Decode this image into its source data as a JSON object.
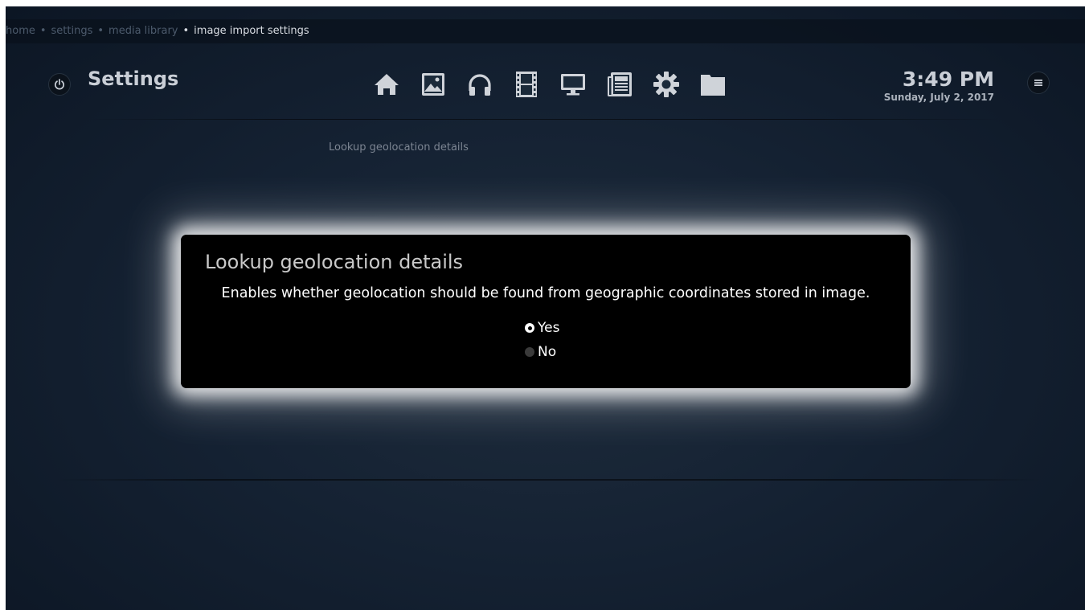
{
  "breadcrumb": {
    "items": [
      "home",
      "settings",
      "media library"
    ],
    "separator": "•",
    "current": "image import settings"
  },
  "header": {
    "title": "Settings",
    "time": "3:49 PM",
    "date": "Sunday, July 2, 2017",
    "nav_icons": [
      "home-icon",
      "pictures-icon",
      "music-icon",
      "videos-icon",
      "tv-icon",
      "news-icon",
      "settings-icon",
      "files-icon"
    ]
  },
  "setting_label": "Lookup geolocation details",
  "dialog": {
    "title": "Lookup geolocation details",
    "description": "Enables whether geolocation should be found from geographic coordinates stored in image.",
    "options": [
      {
        "label": "Yes",
        "selected": true
      },
      {
        "label": "No",
        "selected": false
      }
    ]
  },
  "colors": {
    "background": "#152233",
    "dialog_background": "#000000",
    "dialog_glow": "#ffffff",
    "icon": "#cfd3d9",
    "muted_text": "#4c5a6c"
  }
}
